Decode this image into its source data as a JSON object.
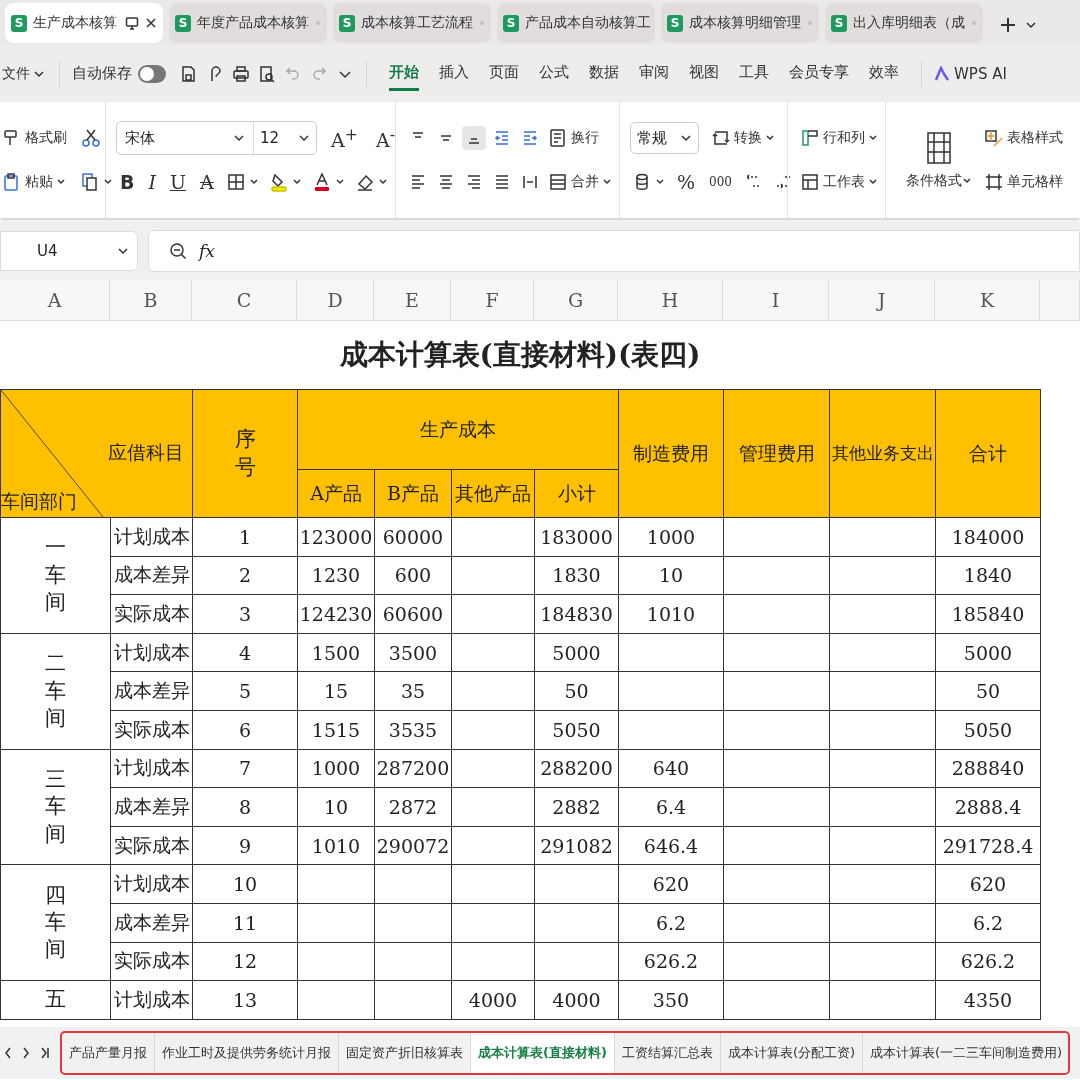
{
  "browser_tabs": [
    {
      "badge": "S",
      "title": "生产成本核算",
      "selected": true
    },
    {
      "badge": "S",
      "title": "年度产品成本核算",
      "selected": false
    },
    {
      "badge": "S",
      "title": "成本核算工艺流程",
      "selected": false
    },
    {
      "badge": "S",
      "title": "产品成本自动核算工",
      "selected": false
    },
    {
      "badge": "S",
      "title": "成本核算明细管理",
      "selected": false
    },
    {
      "badge": "S",
      "title": "出入库明细表（成",
      "selected": false
    }
  ],
  "quick_bar": {
    "file_menu": "文件",
    "autosave": {
      "label": "自动保存",
      "on": false
    }
  },
  "ribbon_tabs": [
    {
      "label": "开始",
      "selected": true
    },
    {
      "label": "插入",
      "selected": false
    },
    {
      "label": "页面",
      "selected": false
    },
    {
      "label": "公式",
      "selected": false
    },
    {
      "label": "数据",
      "selected": false
    },
    {
      "label": "审阅",
      "selected": false
    },
    {
      "label": "视图",
      "selected": false
    },
    {
      "label": "工具",
      "selected": false
    },
    {
      "label": "会员专享",
      "selected": false
    },
    {
      "label": "效率",
      "selected": false
    }
  ],
  "ai_button": "WPS AI",
  "ribbon": {
    "format_painter": "格式刷",
    "paste": "粘贴",
    "font_name": "宋体",
    "font_size": "12",
    "grow_font": "A$^{+}$",
    "shrink_font": "A$^{-}$",
    "style_buttons": [
      {
        "kind": "bold",
        "label": "B"
      },
      {
        "kind": "italic",
        "label": "I"
      },
      {
        "kind": "underline",
        "label": "U"
      },
      {
        "kind": "strike",
        "label": "A"
      }
    ],
    "align_buttons": [
      {
        "selected": false
      },
      {
        "selected": false
      },
      {
        "selected": true
      },
      {
        "selected": false
      },
      {
        "selected": false
      }
    ],
    "wrap": "换行",
    "merge": "合并",
    "number_format": "常规",
    "convert": "转换",
    "percent": "%",
    "thousands": "000",
    "rows_cols": "行和列",
    "worksheet": "工作表",
    "cond_format": "条件格式",
    "table_style": "表格样式",
    "cell_style": "单元格样"
  },
  "formula_bar": {
    "cell_ref": "U4",
    "fx": "fx"
  },
  "columns": [
    "A",
    "B",
    "C",
    "D",
    "E",
    "F",
    "G",
    "H",
    "I",
    "J",
    "K"
  ],
  "sheet": {
    "title": "成本计算表(直接材料)(表四)",
    "header": {
      "subject": "应借科目",
      "dept": "车间部门",
      "seq": "序号",
      "production": "生产成本",
      "production_cols": [
        "A产品",
        "B产品",
        "其他产品",
        "小计"
      ],
      "other_cols": [
        "制造费用",
        "管理费用",
        "其他业务支出",
        "合计"
      ]
    },
    "groups": [
      {
        "label": "一车间",
        "rows": [
          {
            "item": "计划成本",
            "no": "1",
            "a": "123000",
            "b": "60000",
            "sub": "183000",
            "mfg": "1000",
            "total": "184000"
          },
          {
            "item": "成本差异",
            "no": "2",
            "a": "1230",
            "b": "600",
            "sub": "1830",
            "mfg": "10",
            "total": "1840"
          },
          {
            "item": "实际成本",
            "no": "3",
            "a": "124230",
            "b": "60600",
            "sub": "184830",
            "mfg": "1010",
            "total": "185840"
          }
        ]
      },
      {
        "label": "二车间",
        "rows": [
          {
            "item": "计划成本",
            "no": "4",
            "a": "1500",
            "b": "3500",
            "sub": "5000",
            "total": "5000"
          },
          {
            "item": "成本差异",
            "no": "5",
            "a": "15",
            "b": "35",
            "sub": "50",
            "total": "50"
          },
          {
            "item": "实际成本",
            "no": "6",
            "a": "1515",
            "b": "3535",
            "sub": "5050",
            "total": "5050"
          }
        ]
      },
      {
        "label": "三车间",
        "rows": [
          {
            "item": "计划成本",
            "no": "7",
            "a": "1000",
            "b": "287200",
            "sub": "288200",
            "mfg": "640",
            "total": "288840"
          },
          {
            "item": "成本差异",
            "no": "8",
            "a": "10",
            "b": "2872",
            "sub": "2882",
            "mfg": "6.4",
            "total": "2888.4"
          },
          {
            "item": "实际成本",
            "no": "9",
            "a": "1010",
            "b": "290072",
            "sub": "291082",
            "mfg": "646.4",
            "total": "291728.4"
          }
        ]
      },
      {
        "label": "四车间",
        "rows": [
          {
            "item": "计划成本",
            "no": "10",
            "mfg": "620",
            "total": "620"
          },
          {
            "item": "成本差异",
            "no": "11",
            "mfg": "6.2",
            "total": "6.2"
          },
          {
            "item": "实际成本",
            "no": "12",
            "mfg": "626.2",
            "total": "626.2"
          }
        ]
      },
      {
        "label": "五",
        "rows": [
          {
            "item": "计划成本",
            "no": "13",
            "other": "4000",
            "sub": "4000",
            "mfg": "350",
            "total": "4350"
          }
        ]
      }
    ]
  },
  "sheet_tabs": {
    "highlighted": true,
    "tabs": [
      {
        "label": "产品产量月报",
        "selected": false
      },
      {
        "label": "作业工时及提供劳务统计月报",
        "selected": false
      },
      {
        "label": "固定资产折旧核算表",
        "selected": false
      },
      {
        "label": "成本计算表(直接材料)",
        "selected": true
      },
      {
        "label": "工资结算汇总表",
        "selected": false
      },
      {
        "label": "成本计算表(分配工资)",
        "selected": false
      },
      {
        "label": "成本计算表(一二三车间制造费用)",
        "selected": false
      }
    ]
  }
}
